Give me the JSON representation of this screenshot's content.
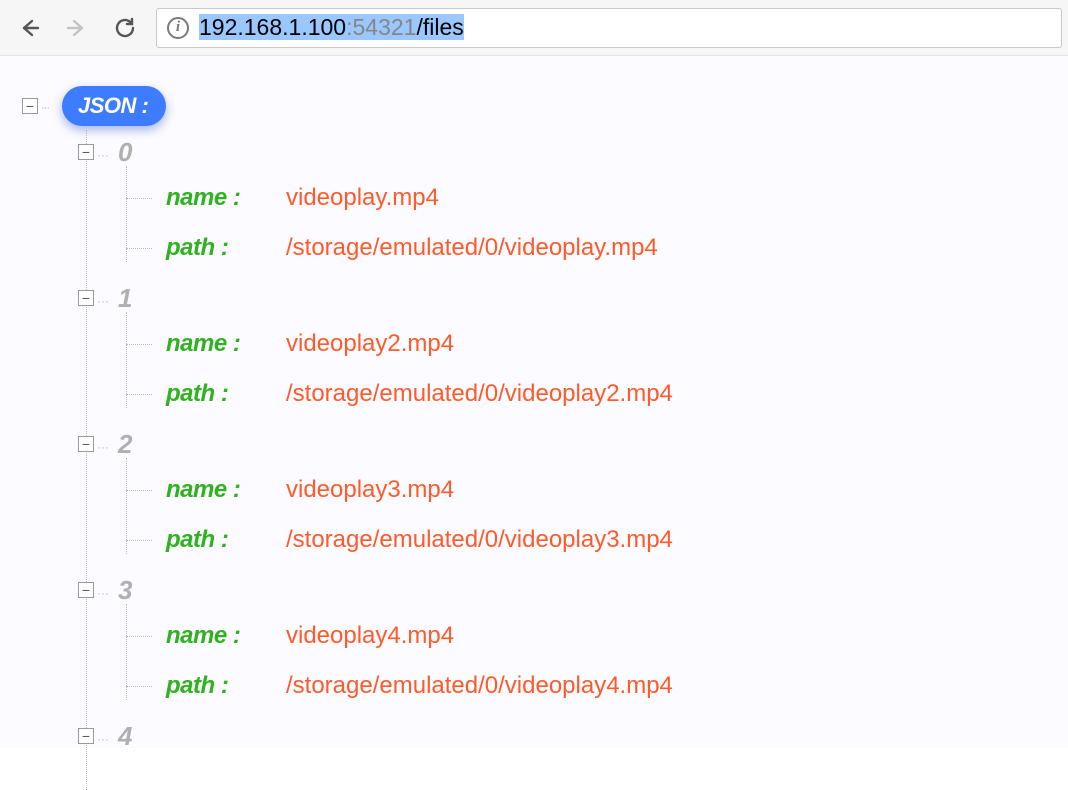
{
  "browser": {
    "url_ip": "192.168.1.100",
    "url_port": ":54321",
    "url_path": "/files"
  },
  "tree": {
    "rootLabel": "JSON :",
    "keyNameLabel": "name :",
    "keyPathLabel": "path :",
    "indices": [
      "0",
      "1",
      "2",
      "3",
      "4"
    ],
    "items": [
      {
        "name": "videoplay.mp4",
        "path": "/storage/emulated/0/videoplay.mp4"
      },
      {
        "name": "videoplay2.mp4",
        "path": "/storage/emulated/0/videoplay2.mp4"
      },
      {
        "name": "videoplay3.mp4",
        "path": "/storage/emulated/0/videoplay3.mp4"
      },
      {
        "name": "videoplay4.mp4",
        "path": "/storage/emulated/0/videoplay4.mp4"
      }
    ]
  }
}
